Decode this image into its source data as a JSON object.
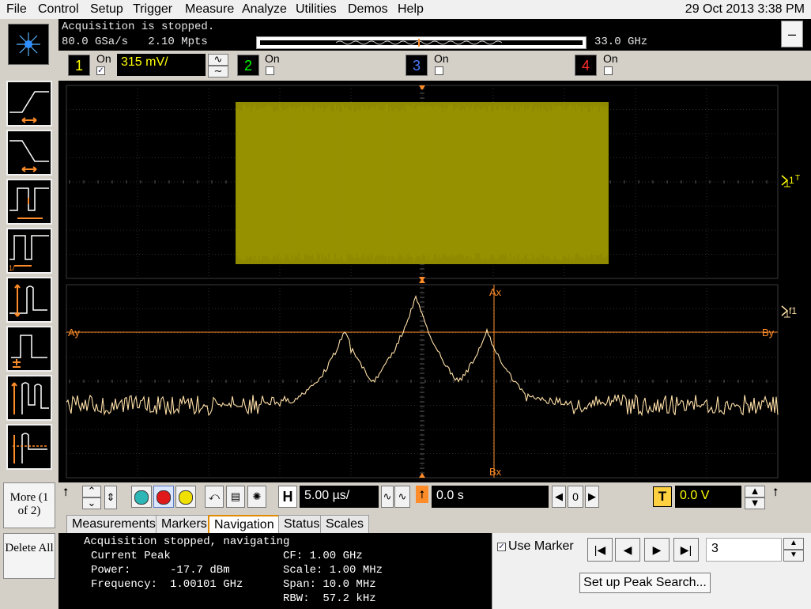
{
  "menu": {
    "items": [
      "File",
      "Control",
      "Setup",
      "Trigger",
      "Measure",
      "Analyze",
      "Utilities",
      "Demos",
      "Help"
    ],
    "datetime": "29 Oct 2013  3:38 PM"
  },
  "acquisition": {
    "status": "Acquisition is stopped.",
    "rate": "80.0 GSa/s   2.10 Mpts",
    "bandwidth": "33.0 GHz",
    "minimize_label": "–"
  },
  "channels": {
    "ch1": {
      "number": "1",
      "on_label": "On",
      "scale": "315 mV/",
      "checked": true,
      "color": "#ffff00"
    },
    "ch2": {
      "number": "2",
      "on_label": "On",
      "checked": false,
      "color": "#00ff00"
    },
    "ch3": {
      "number": "3",
      "on_label": "On",
      "checked": false,
      "color": "#4a7dff"
    },
    "ch4": {
      "number": "4",
      "on_label": "On",
      "checked": false,
      "color": "#ff2a2a"
    }
  },
  "waveform": {
    "channel_marker": "1",
    "fft_marker": "f1",
    "trace_color": "#b8b000",
    "fft_color": "#ffe0a8",
    "marker_color": "#ff8c28",
    "marker_labels": {
      "ax": "Ax",
      "bx": "Bx",
      "ay": "Ay",
      "by": "By"
    }
  },
  "left_buttons": {
    "more": "More (1 of 2)",
    "delete_all": "Delete All"
  },
  "horizontal": {
    "h_label": "H",
    "scale": "5.00 µs/",
    "position": "0.0 s",
    "zero_label": "0",
    "t_label": "T",
    "trigger_level": "0.0 V"
  },
  "tabs": [
    "Measurements",
    "Markers",
    "Navigation",
    "Status",
    "Scales"
  ],
  "active_tab": "Navigation",
  "info": {
    "line1": "Acquisition stopped, navigating",
    "current_peak_label": "Current Peak",
    "power_label": "Power:",
    "power_value": "-17.7 dBm",
    "frequency_label": "Frequency:",
    "frequency_value": "1.00101 GHz",
    "cf": "CF: 1.00 GHz",
    "scale": "Scale: 1.00 MHz",
    "span": "Span: 10.0 MHz",
    "rbw": "RBW:  57.2 kHz"
  },
  "marker_panel": {
    "use_marker_label": "Use Marker",
    "use_marker_checked": true,
    "peak_number": "3",
    "setup_peak_search": "Set up Peak Search..."
  }
}
